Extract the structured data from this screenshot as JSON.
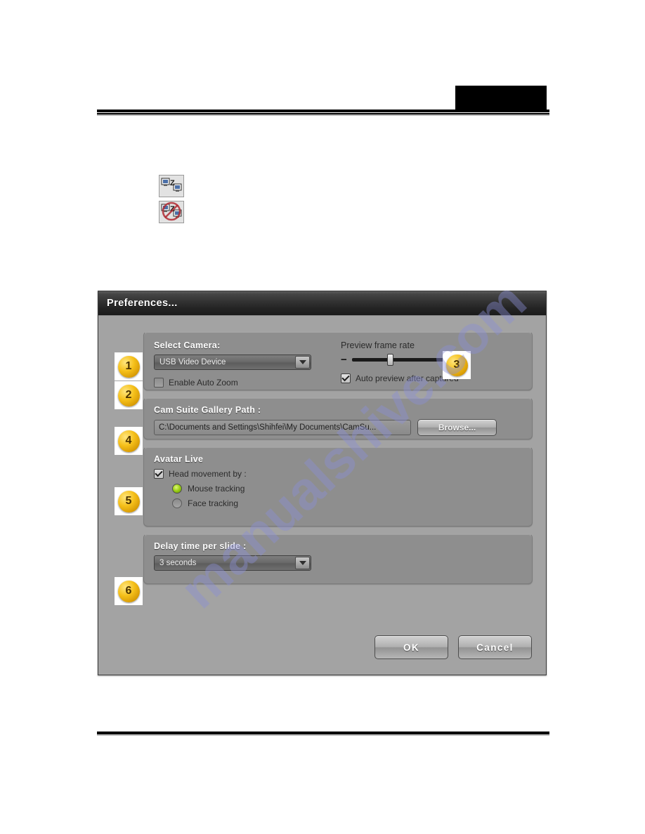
{
  "page": {
    "watermark": "manualshive.com",
    "redaction_box": true
  },
  "toolbar_icons": [
    {
      "name": "network-zoom-icon",
      "label": "Network Zoom"
    },
    {
      "name": "network-zoom-disabled-icon",
      "label": "Network Zoom Disabled"
    }
  ],
  "dialog": {
    "title": "Preferences...",
    "camera_panel": {
      "title": "Select Camera:",
      "camera_value": "USB Video Device",
      "auto_zoom_label": "Enable Auto Zoom",
      "auto_zoom_checked": false,
      "preview_frame_rate_label": "Preview frame rate",
      "slider_minus": "−",
      "slider_plus": "+",
      "slider_percent": 38,
      "auto_preview_label": "Auto preview after captured",
      "auto_preview_checked": true
    },
    "gallery_panel": {
      "title": "Cam Suite Gallery Path :",
      "path_value": "C:\\Documents and Settings\\Shihfei\\My Documents\\CamSu...",
      "browse_label": "Browse..."
    },
    "avatar_panel": {
      "title": "Avatar Live",
      "head_movement_label": "Head movement by :",
      "head_movement_checked": true,
      "options": [
        {
          "label": "Mouse tracking",
          "selected": true
        },
        {
          "label": "Face tracking",
          "selected": false
        }
      ]
    },
    "delay_panel": {
      "title": "Delay time per slide :",
      "delay_value": "3 seconds"
    },
    "footer": {
      "ok_label": "OK",
      "cancel_label": "Cancel"
    }
  },
  "callouts": [
    {
      "number": "1"
    },
    {
      "number": "2"
    },
    {
      "number": "3"
    },
    {
      "number": "4"
    },
    {
      "number": "5"
    },
    {
      "number": "6"
    }
  ],
  "colors": {
    "badge": "#f5c01a",
    "dialog_bg": "#a3a3a3",
    "panel_bg": "#8e8e8e",
    "titlebar": "#242424",
    "watermark": "#8b8fd6",
    "radio_on": "#9fd219"
  }
}
